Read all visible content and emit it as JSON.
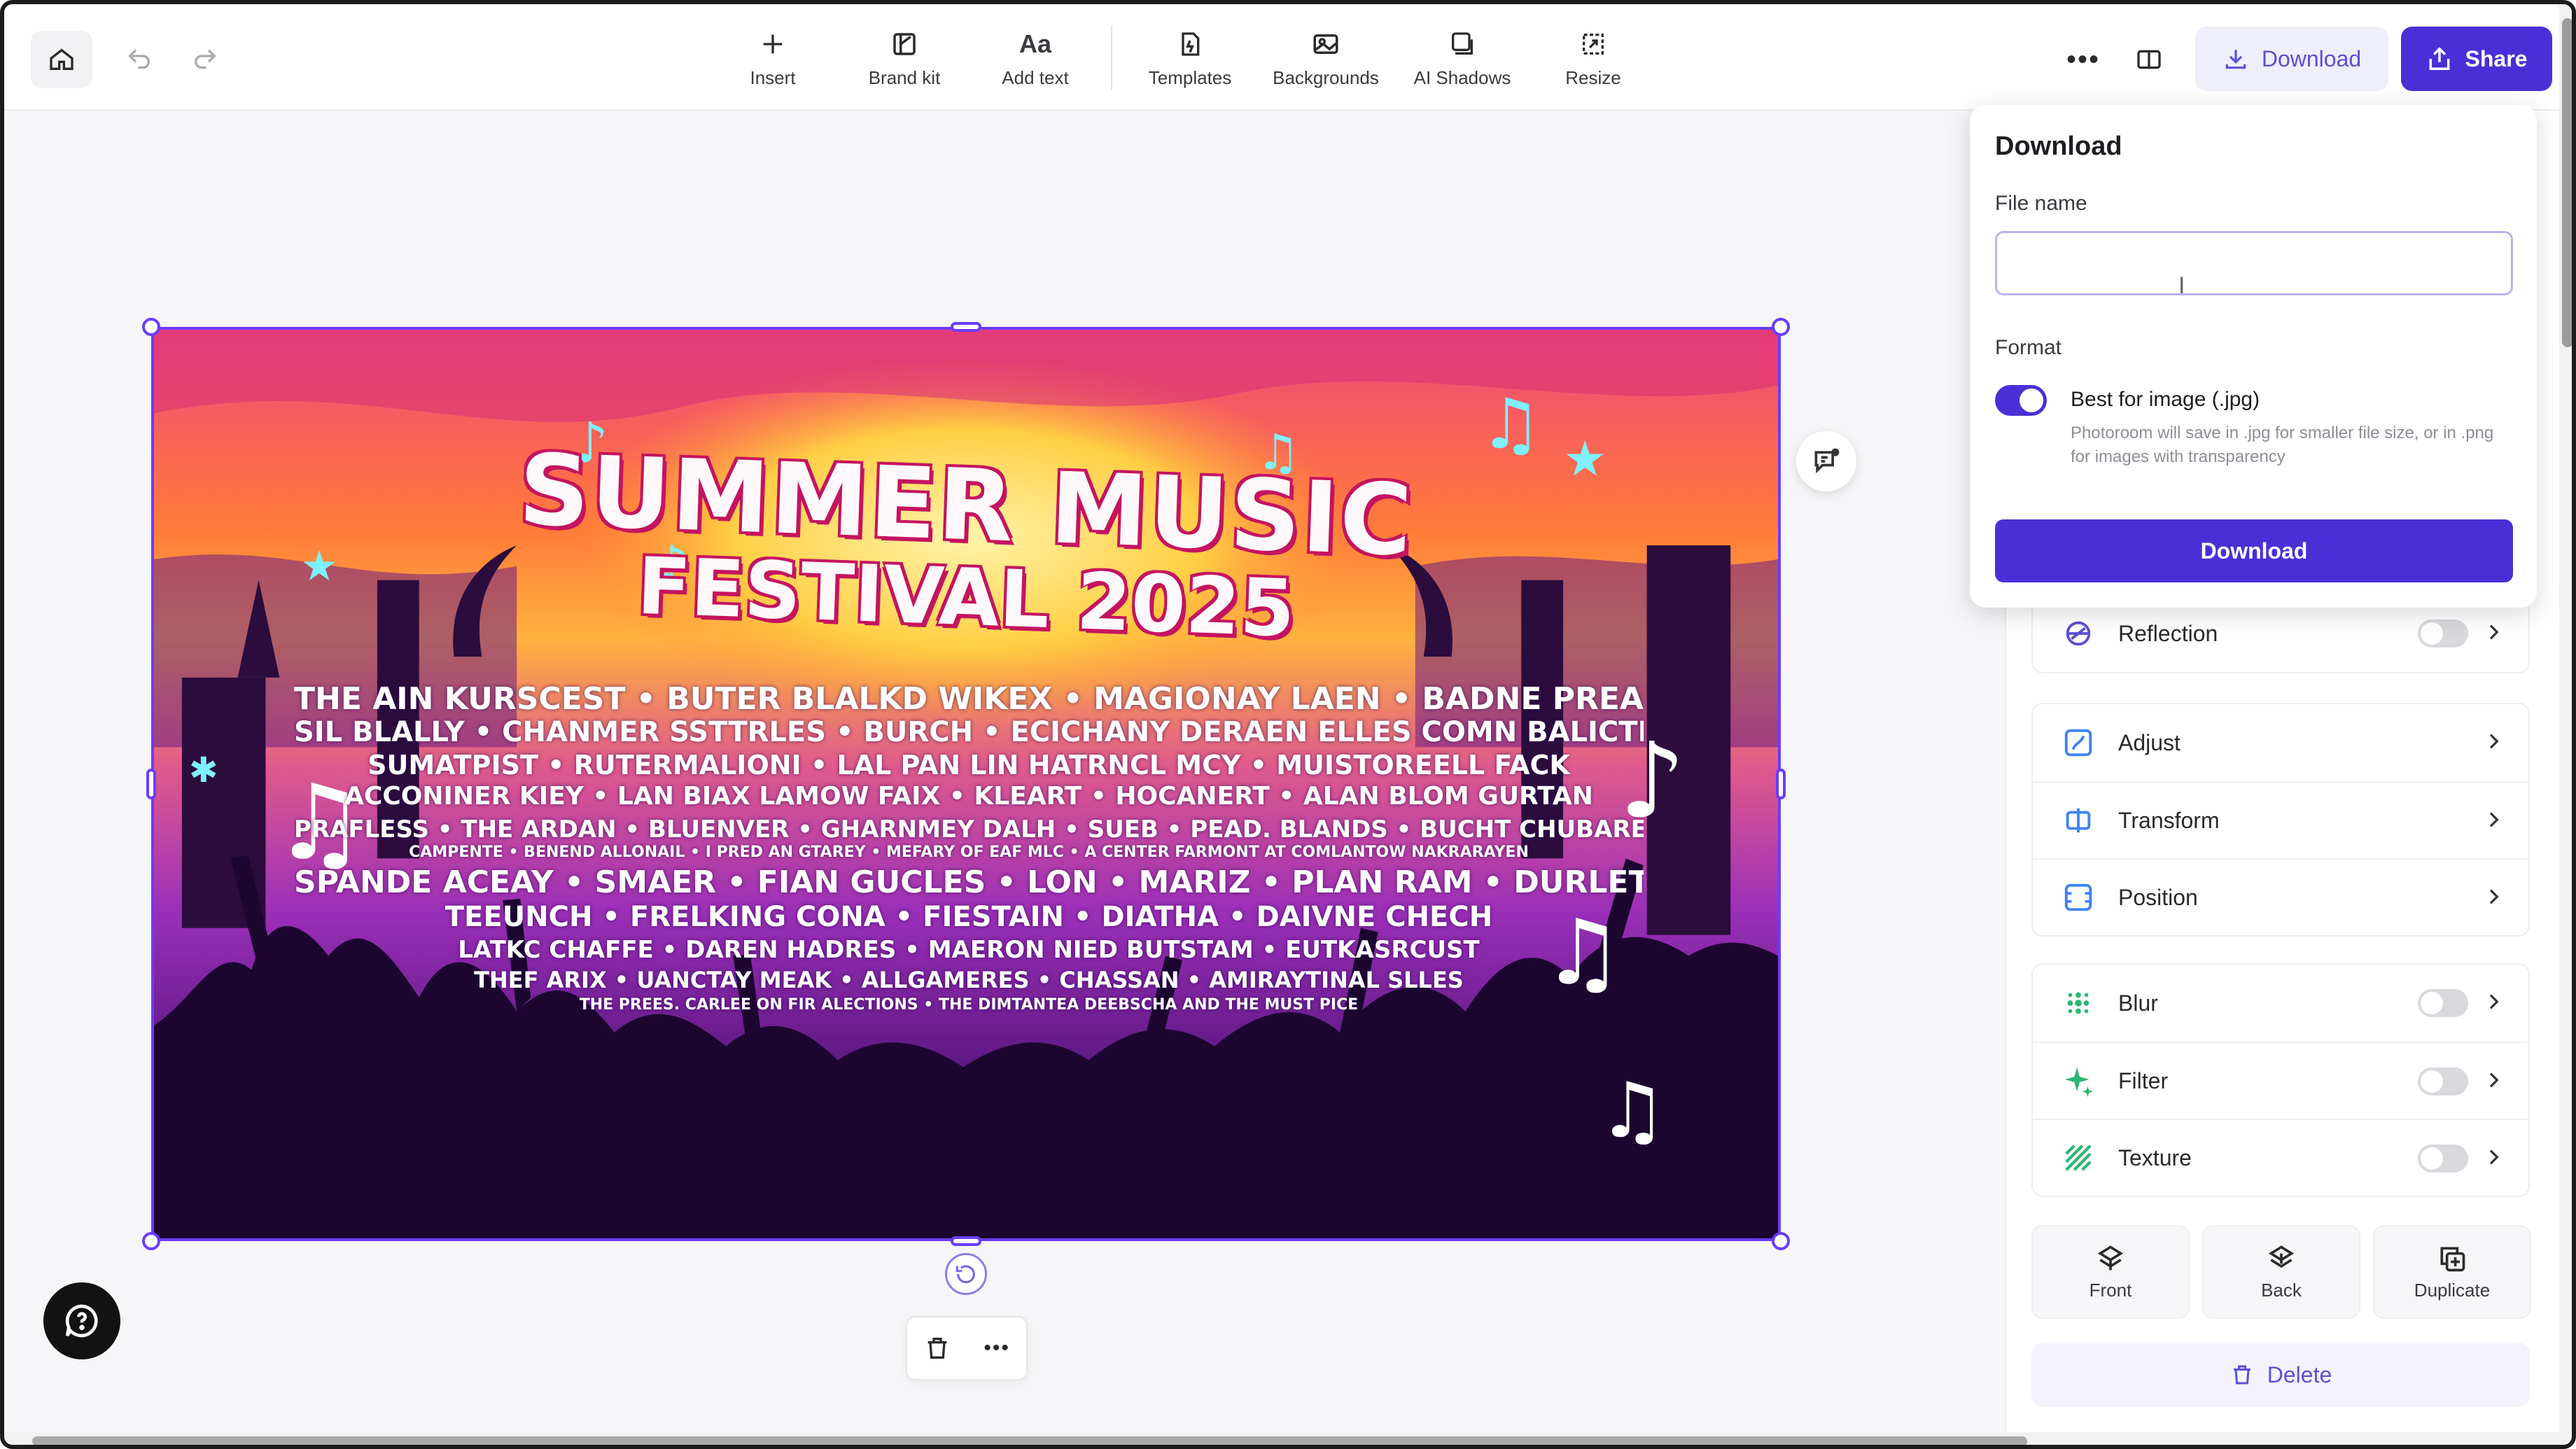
{
  "toolbar": {
    "tools": [
      {
        "label": "Insert",
        "icon": "plus-icon"
      },
      {
        "label": "Brand kit",
        "icon": "brand-kit-icon"
      },
      {
        "label": "Add text",
        "icon": "text-aa-icon"
      },
      {
        "label": "Templates",
        "icon": "templates-icon"
      },
      {
        "label": "Backgrounds",
        "icon": "backgrounds-icon"
      },
      {
        "label": "AI Shadows",
        "icon": "ai-shadows-icon"
      },
      {
        "label": "Resize",
        "icon": "resize-icon"
      }
    ],
    "download_label": "Download",
    "share_label": "Share"
  },
  "poster": {
    "title_line1": "SUMMER MUSIC",
    "title_line2": "FESTIVAL 2025",
    "lineup": [
      "THE AIN KURSCEST • BUTER BLALKD WIKEX • MAGIONAY LAEN • BADNE PREAPEN • CLAULINER",
      "SIL BLALLY • CHANMER SSTTRLES • BURCH • ECICHANY DERAEN ELLES COMN BALICTIONE",
      "SUMATPIST • RUTERMALIONI • LAL PAN LIN HATRNCL MCY • MUISTOREELL FACK",
      "ACCONINER KIEY • LAN BIAX LAMOW FAIX • KLEART • HOCANERT • ALAN BLOM GURTAN",
      "PRAFLESS • THE ARDAN • BLUENVER • GHARNMEY DALH • SUEB • PEAD. BLANDS • BUCHT CHUBARED",
      "CAMPENTE • BENEND ALLONAIL • I PRED AN GTAREY • MEFARY OF EAF MLC • A CENTER FARMONT AT COMLANTOW NAKRARAYEN",
      "SPANDE ACEAY • SMAER • FIAN GUCLES • LON • MARIZ • PLAN RAM • DURLET",
      "TEEUNCH • FRELKING CONA • FIESTAIN • DIATHA • DAIVNE CHECH",
      "LATKC CHAFFE • DAREN HADRES • MAERON NIED BUTSTAM • EUTKASRCUST",
      "THEF ARIX • UANCTAY MEAK • ALLGAMERES • CHASSAN • AMIRAYTINAL SLLES",
      "THE PREES. CARLEE ON FIR ALECTIONS • THE DIMTANTEA DEEBSCHA AND THE MUST PICE"
    ]
  },
  "download_popup": {
    "title": "Download",
    "file_name_label": "File name",
    "file_name_value": "",
    "format_label": "Format",
    "format_option": "Best for image (.jpg)",
    "format_toggle_on": true,
    "format_description": "Photoroom will save in .jpg for smaller file size, or in .png for images with transparency",
    "download_button": "Download"
  },
  "properties": {
    "reflection": {
      "label": "Reflection",
      "enabled": false
    },
    "group_adjust": [
      {
        "label": "Adjust",
        "icon": "adjust-icon"
      },
      {
        "label": "Transform",
        "icon": "transform-icon"
      },
      {
        "label": "Position",
        "icon": "position-icon"
      }
    ],
    "group_effects": [
      {
        "label": "Blur",
        "icon": "blur-icon",
        "enabled": false
      },
      {
        "label": "Filter",
        "icon": "filter-icon",
        "enabled": false
      },
      {
        "label": "Texture",
        "icon": "texture-icon",
        "enabled": false
      }
    ],
    "actions": [
      {
        "label": "Front",
        "icon": "bring-front-icon"
      },
      {
        "label": "Back",
        "icon": "send-back-icon"
      },
      {
        "label": "Duplicate",
        "icon": "duplicate-icon"
      }
    ],
    "delete_label": "Delete"
  },
  "colors": {
    "accent": "#4b2fd6",
    "accent_light": "#efeefb",
    "selection": "#6a3cff",
    "icon_blue": "#3b82f6",
    "icon_green": "#2bb673"
  }
}
